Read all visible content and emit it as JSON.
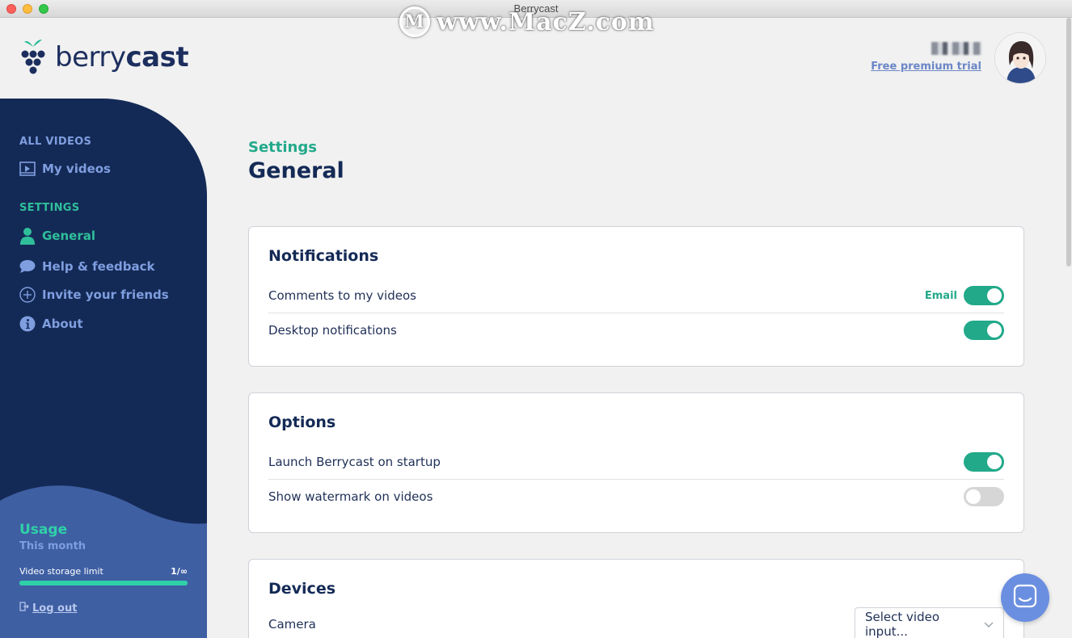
{
  "window": {
    "title": "Berrycast",
    "watermark": "www.MacZ.com",
    "watermark_logo": "M"
  },
  "header": {
    "logo_light": "berry",
    "logo_bold": "cast",
    "trial_link": "Free premium trial",
    "icons": {
      "logo": "berry-logo-icon",
      "avatar": "user-avatar"
    }
  },
  "sidebar": {
    "all_videos_heading": "ALL VIDEOS",
    "my_videos": "My videos",
    "settings_heading": "SETTINGS",
    "items": [
      {
        "label": "General",
        "icon": "person-icon"
      },
      {
        "label": "Help & feedback",
        "icon": "speech-bubble-icon"
      },
      {
        "label": "Invite your friends",
        "icon": "plus-circle-icon"
      },
      {
        "label": "About",
        "icon": "info-icon"
      }
    ],
    "usage": {
      "title": "Usage",
      "subtitle": "This month",
      "storage_label": "Video storage limit",
      "storage_value": "1/∞",
      "storage_fill": 1.0
    },
    "logout": "Log out"
  },
  "main": {
    "breadcrumb": "Settings",
    "title": "General",
    "notifications": {
      "title": "Notifications",
      "comments_label": "Comments to my videos",
      "email_label": "Email",
      "comments_email_on": true,
      "desktop_label": "Desktop notifications",
      "desktop_on": true
    },
    "options": {
      "title": "Options",
      "launch_label": "Launch Berrycast on startup",
      "launch_on": true,
      "watermark_label": "Show watermark on videos",
      "watermark_on": false
    },
    "devices": {
      "title": "Devices",
      "camera_label": "Camera",
      "camera_select": "Select video input..."
    }
  },
  "colors": {
    "sidebar": "#142a56",
    "accent": "#22a98a",
    "link": "#6b86c6",
    "chat": "#6b8fe0"
  }
}
